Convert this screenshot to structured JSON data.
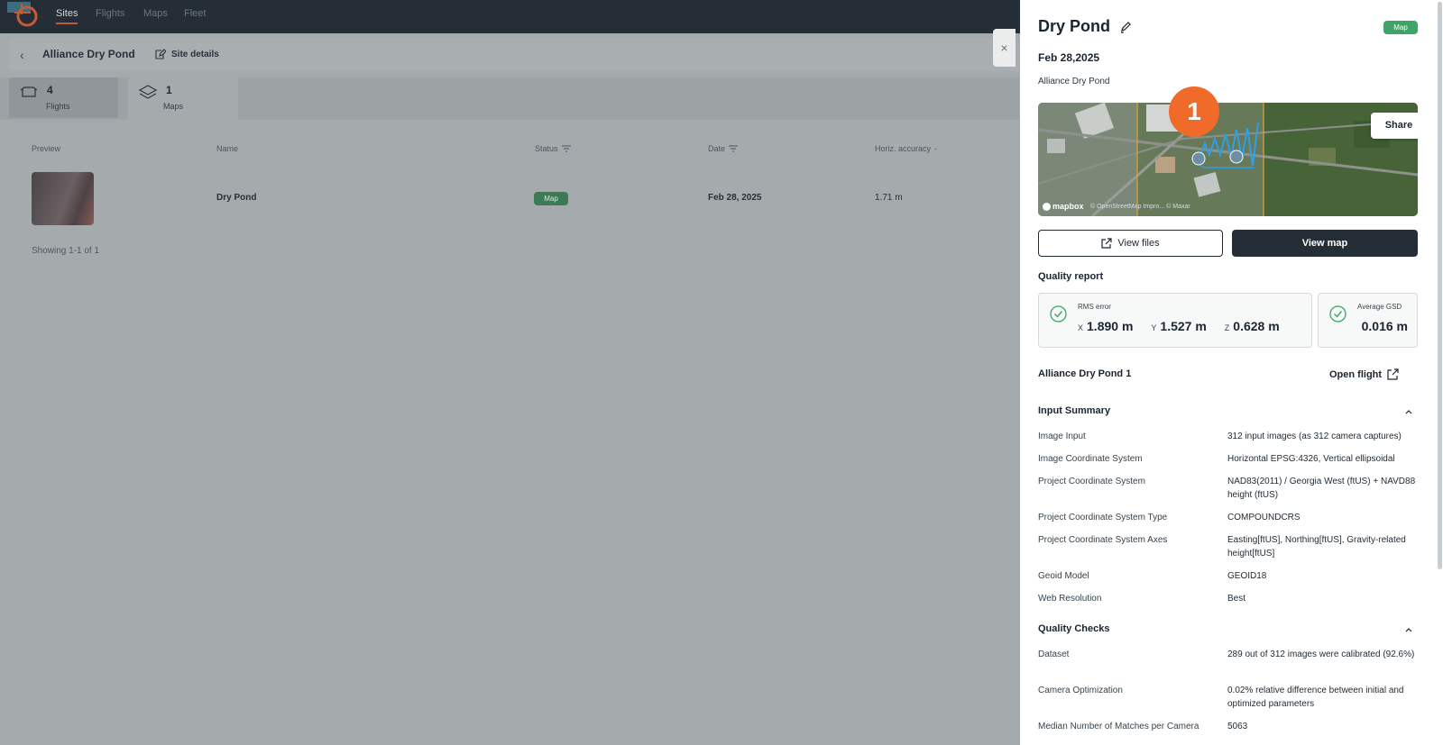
{
  "nav": {
    "tabs": [
      "Sites",
      "Flights",
      "Maps",
      "Fleet"
    ]
  },
  "breadcrumb": {
    "site_name": "Alliance Dry Pond",
    "site_details": "Site details"
  },
  "stats": {
    "flights_count": "4",
    "flights_label": "Flights",
    "maps_count": "1",
    "maps_label": "Maps"
  },
  "table": {
    "headers": [
      "Preview",
      "Name",
      "Status",
      "Date",
      "Horiz. accuracy"
    ],
    "rows": [
      {
        "name": "Dry Pond",
        "status": "Map",
        "date": "Feb 28, 2025",
        "accuracy": "1.71 m"
      }
    ],
    "showing": "Showing 1-1 of 1"
  },
  "close_label": "×",
  "panel": {
    "title": "Dry Pond",
    "badge": "Map",
    "date": "Feb 28,2025",
    "site": "Alliance Dry Pond",
    "share": "Share",
    "mapbox": "mapbox",
    "attribution": "© OpenStreetMap  Impro...  © Maxar",
    "step_number": "1",
    "view_files": "View files",
    "view_map": "View map",
    "quality_report": "Quality report",
    "rms": {
      "label": "RMS error",
      "x_axis": "X",
      "x_value": "1.890 m",
      "y_axis": "Y",
      "y_value": "1.527 m",
      "z_axis": "Z",
      "z_value": "0.628 m"
    },
    "gsd": {
      "label": "Average GSD",
      "value": "0.016 m"
    },
    "flight_name": "Alliance Dry Pond 1",
    "open_flight": "Open flight",
    "input_summary": {
      "title": "Input Summary",
      "rows": [
        {
          "label": "Image Input",
          "value": "312 input images (as 312 camera captures)"
        },
        {
          "label": "Image Coordinate System",
          "value": "Horizontal EPSG:4326, Vertical ellipsoidal"
        },
        {
          "label": "Project Coordinate System",
          "value": "NAD83(2011) / Georgia West (ftUS) + NAVD88 height (ftUS)"
        },
        {
          "label": "Project Coordinate System Type",
          "value": "COMPOUNDCRS"
        },
        {
          "label": "Project Coordinate System Axes",
          "value": "Easting[ftUS], Northing[ftUS], Gravity-related height[ftUS]"
        },
        {
          "label": "Geoid Model",
          "value": "GEOID18"
        },
        {
          "label": "Web Resolution",
          "value": "Best"
        }
      ]
    },
    "quality_checks": {
      "title": "Quality Checks",
      "rows": [
        {
          "label": "Dataset",
          "value": "289 out of 312 images were calibrated (92.6%)"
        },
        {
          "label": "Camera Optimization",
          "value": "0.02% relative difference between initial and optimized parameters"
        },
        {
          "label": "Median Number of Matches per Camera",
          "value": "5063"
        }
      ]
    }
  },
  "colors": {
    "accent_green": "#3ea567",
    "step_orange": "#f06a2a",
    "dark": "#252e36",
    "flight_path": "#2f9fe6"
  }
}
